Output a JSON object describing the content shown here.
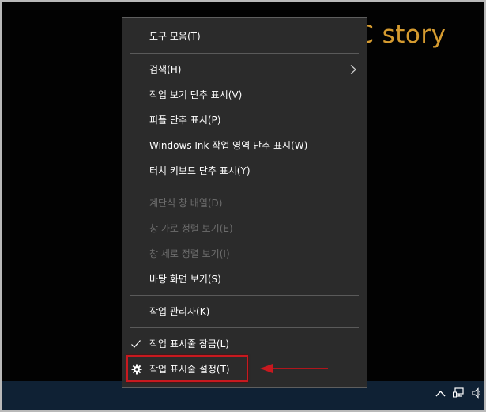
{
  "watermark": "OPC story",
  "context_menu": {
    "items": [
      {
        "label": "도구 모음(T)"
      },
      {
        "label": "검색(H)"
      },
      {
        "label": "작업 보기 단추 표시(V)"
      },
      {
        "label": "피플 단추 표시(P)"
      },
      {
        "label": "Windows Ink 작업 영역 단추 표시(W)"
      },
      {
        "label": "터치 키보드 단추 표시(Y)"
      },
      {
        "label": "계단식 창 배열(D)"
      },
      {
        "label": "창 가로 정렬 보기(E)"
      },
      {
        "label": "창 세로 정렬 보기(I)"
      },
      {
        "label": "바탕 화면 보기(S)"
      },
      {
        "label": "작업 관리자(K)"
      },
      {
        "label": "작업 표시줄 잠금(L)"
      },
      {
        "label": "작업 표시줄 설정(T)"
      }
    ]
  },
  "tray": {
    "icons": [
      "chevron-up-icon",
      "network-icon",
      "volume-icon"
    ]
  },
  "colors": {
    "menu_bg": "#2b2b2b",
    "menu_text": "#ffffff",
    "disabled_text": "#6d6d6d",
    "taskbar": "#0f2134",
    "highlight": "#c8191f",
    "watermark": "#d59b30"
  }
}
